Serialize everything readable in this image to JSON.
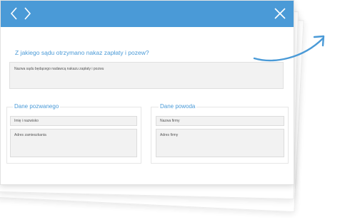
{
  "titlebar": {
    "back_icon": "chevron-left-icon",
    "forward_icon": "chevron-right-icon",
    "close_icon": "close-icon",
    "color": "#4a9ad7"
  },
  "main": {
    "question": "Z jakiego sądu otrzymano nakaz zapłaty i pozew?",
    "court_placeholder": "Nazwa sądu będącego nadawcą nakazu zapłaty i pozwu"
  },
  "defendant": {
    "legend": "Dane pozwanego",
    "name_placeholder": "Imię i nazwisko",
    "address_placeholder": "Adres zamieszkania"
  },
  "plaintiff": {
    "legend": "Dane powoda",
    "company_placeholder": "Nazwa firmy",
    "address_placeholder": "Adres firmy"
  },
  "decoration": {
    "arrow_icon": "curved-arrow-icon",
    "arrow_color": "#4a9ad7"
  }
}
